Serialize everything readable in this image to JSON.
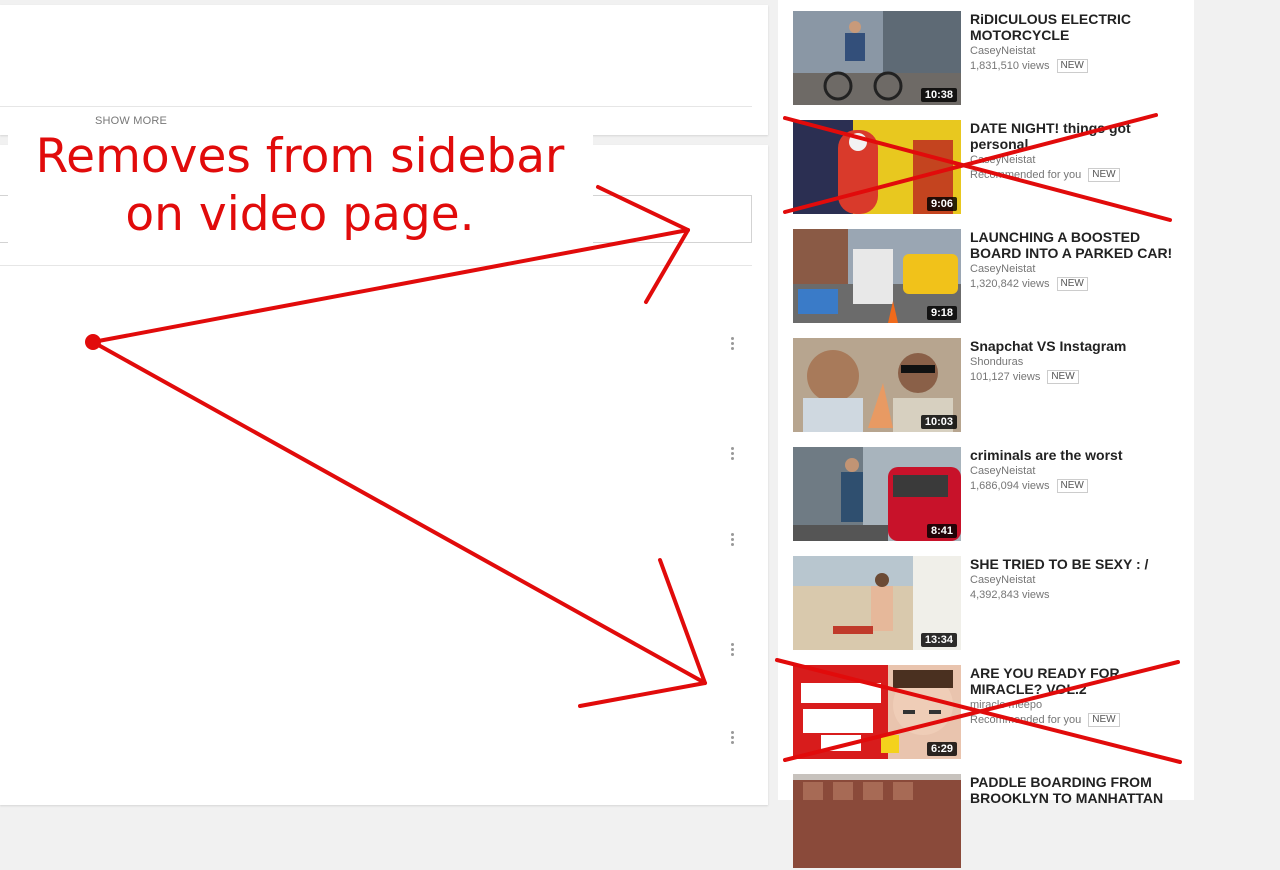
{
  "description": {
    "show_more_label": "SHOW MORE"
  },
  "annotation": {
    "line1": "Removes from sidebar",
    "line2": "on video page."
  },
  "sidebar": {
    "videos": [
      {
        "title": "RiDICULOUS ELECTRIC MOTORCYCLE",
        "channel": "CaseyNeistat",
        "meta": "1,831,510 views",
        "badge": "NEW",
        "duration": "10:38",
        "crossed_out": false
      },
      {
        "title": "DATE NIGHT! things got personal",
        "channel": "CaseyNeistat",
        "meta": "Recommended for you",
        "badge": "NEW",
        "duration": "9:06",
        "crossed_out": true
      },
      {
        "title": "LAUNCHING A BOOSTED BOARD INTO A PARKED CAR!",
        "channel": "CaseyNeistat",
        "meta": "1,320,842 views",
        "badge": "NEW",
        "duration": "9:18",
        "crossed_out": false
      },
      {
        "title": "Snapchat VS Instagram",
        "channel": "Shonduras",
        "meta": "101,127 views",
        "badge": "NEW",
        "duration": "10:03",
        "crossed_out": false
      },
      {
        "title": "criminals are the worst",
        "channel": "CaseyNeistat",
        "meta": "1,686,094 views",
        "badge": "NEW",
        "duration": "8:41",
        "crossed_out": false
      },
      {
        "title": "SHE TRIED TO BE SEXY : /",
        "channel": "CaseyNeistat",
        "meta": "4,392,843 views",
        "badge": "",
        "duration": "13:34",
        "crossed_out": false
      },
      {
        "title": "ARE YOU READY FOR MIRACLE? VOL.2",
        "channel": "miracle meepo",
        "meta": "Recommended for you",
        "badge": "NEW",
        "duration": "6:29",
        "crossed_out": true
      },
      {
        "title": "PADDLE BOARDING FROM BROOKLYN TO MANHATTAN",
        "channel": "",
        "meta": "",
        "badge": "",
        "duration": "",
        "crossed_out": false
      }
    ]
  },
  "colors": {
    "annotation_red": "#e10b0b",
    "text_primary": "#222222",
    "text_secondary": "#767676"
  },
  "icons": {
    "more_actions": "kebab-menu-icon"
  }
}
